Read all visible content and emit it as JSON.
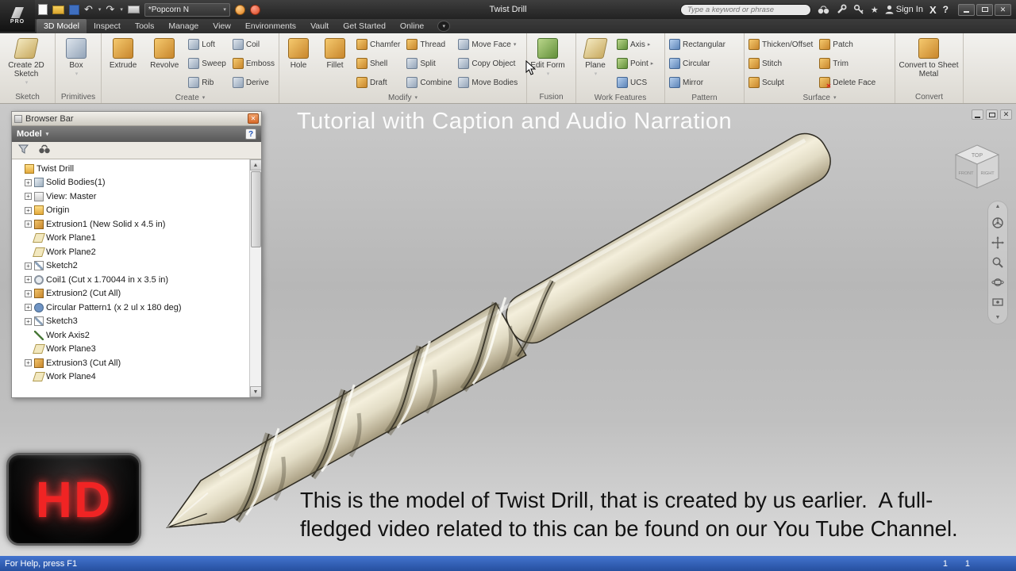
{
  "titlebar": {
    "app_label": "PRO",
    "doc_combo": "*Popcorn N",
    "title": "Twist Drill",
    "search_placeholder": "Type a keyword or phrase",
    "sign_in": "Sign In",
    "x_logo": "X",
    "help": "?"
  },
  "tabs": {
    "items": [
      "3D Model",
      "Inspect",
      "Tools",
      "Manage",
      "View",
      "Environments",
      "Vault",
      "Get Started",
      "Online"
    ],
    "active": "3D Model"
  },
  "ribbon": {
    "panel_labels": {
      "sketch": "Sketch",
      "primitives": "Primitives",
      "create": "Create",
      "modify": "Modify",
      "fusion": "Fusion",
      "work": "Work Features",
      "pattern": "Pattern",
      "surface": "Surface",
      "convert": "Convert"
    },
    "buttons": {
      "create2d": "Create 2D Sketch",
      "box": "Box",
      "extrude": "Extrude",
      "revolve": "Revolve",
      "loft": "Loft",
      "coil": "Coil",
      "sweep": "Sweep",
      "emboss": "Emboss",
      "rib": "Rib",
      "derive": "Derive",
      "hole": "Hole",
      "fillet": "Fillet",
      "chamfer": "Chamfer",
      "shell": "Shell",
      "draft": "Draft",
      "thread": "Thread",
      "split": "Split",
      "combine": "Combine",
      "move_face": "Move Face",
      "copy_object": "Copy Object",
      "move_bodies": "Move Bodies",
      "edit_form": "Edit Form",
      "plane": "Plane",
      "axis": "Axis",
      "point": "Point",
      "ucs": "UCS",
      "rectangular": "Rectangular",
      "circular": "Circular",
      "mirror": "Mirror",
      "thicken": "Thicken/Offset",
      "stitch": "Stitch",
      "sculpt": "Sculpt",
      "patch": "Patch",
      "trim": "Trim",
      "delete_face": "Delete Face",
      "convert_sm": "Convert to Sheet Metal"
    }
  },
  "browser": {
    "window_title": "Browser Bar",
    "mode": "Model",
    "tree": [
      {
        "exp": "",
        "icon": "folder",
        "label": "Twist Drill"
      },
      {
        "exp": "+",
        "icon": "solid",
        "label": "Solid Bodies(1)"
      },
      {
        "exp": "+",
        "icon": "view",
        "label": "View: Master"
      },
      {
        "exp": "+",
        "icon": "folder",
        "label": "Origin"
      },
      {
        "exp": "+",
        "icon": "extrusion",
        "label": "Extrusion1 (New Solid x 4.5 in)"
      },
      {
        "exp": "",
        "icon": "workplane",
        "label": "Work Plane1"
      },
      {
        "exp": "",
        "icon": "workplane",
        "label": "Work Plane2"
      },
      {
        "exp": "+",
        "icon": "sketch",
        "label": "Sketch2"
      },
      {
        "exp": "+",
        "icon": "coil",
        "label": "Coil1 (Cut x 1.70044 in x 3.5 in)"
      },
      {
        "exp": "+",
        "icon": "extrusion",
        "label": "Extrusion2 (Cut All)"
      },
      {
        "exp": "+",
        "icon": "pattern",
        "label": "Circular Pattern1 (x 2 ul x 180 deg)"
      },
      {
        "exp": "+",
        "icon": "sketch",
        "label": "Sketch3"
      },
      {
        "exp": "",
        "icon": "workaxis",
        "label": "Work Axis2"
      },
      {
        "exp": "",
        "icon": "workplane",
        "label": "Work Plane3"
      },
      {
        "exp": "+",
        "icon": "extrusion",
        "label": "Extrusion3 (Cut All)"
      },
      {
        "exp": "",
        "icon": "workplane",
        "label": "Work Plane4"
      }
    ]
  },
  "viewcube": {
    "top": "TOP",
    "front": "FRONT",
    "right": "RIGHT"
  },
  "overlay": {
    "tutorial": "Tutorial with Caption and Audio Narration",
    "caption_line1": "This is the model of Twist Drill, that is created by us earlier.  A full-",
    "caption_line2": "fledged video related to this can be found on our You Tube Channel.",
    "hd": "HD"
  },
  "statusbar": {
    "help_text": "For Help, press F1",
    "field1": "1",
    "field2": "1"
  },
  "colors": {
    "status_blue": "#2c55a8",
    "hd_red": "#f02424",
    "icon_amber": "#d99a3d",
    "icon_slate": "#8fa0b5"
  }
}
